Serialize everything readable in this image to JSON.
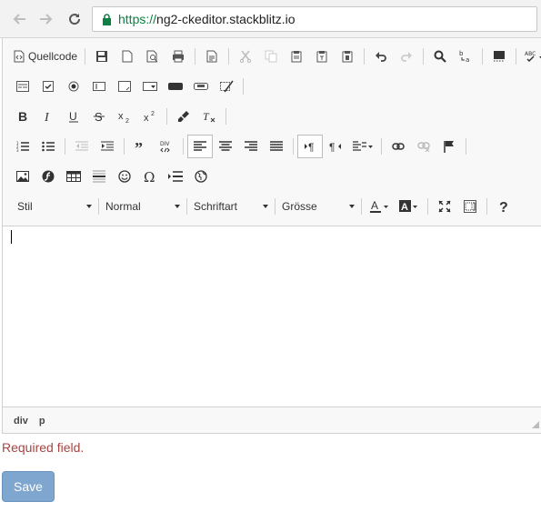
{
  "browser": {
    "url_scheme": "https://",
    "url_host": "ng2-ckeditor.stackblitz.io"
  },
  "toolbar": {
    "source_label": "Quellcode",
    "style_combo": "Stil",
    "format_combo": "Normal",
    "font_combo": "Schriftart",
    "size_combo": "Grösse"
  },
  "elements_path": [
    "div",
    "p"
  ],
  "form": {
    "error_text": "Required field.",
    "save_label": "Save"
  },
  "colors": {
    "url_green": "#0b8043",
    "error": "#a94442",
    "save_bg": "#7ea6cf"
  }
}
